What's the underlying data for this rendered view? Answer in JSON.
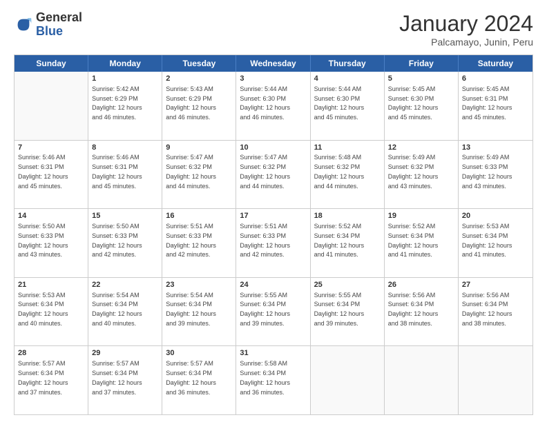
{
  "logo": {
    "general": "General",
    "blue": "Blue"
  },
  "title": "January 2024",
  "location": "Palcamayo, Junin, Peru",
  "days": [
    "Sunday",
    "Monday",
    "Tuesday",
    "Wednesday",
    "Thursday",
    "Friday",
    "Saturday"
  ],
  "weeks": [
    [
      {
        "day": "",
        "text": ""
      },
      {
        "day": "1",
        "text": "Sunrise: 5:42 AM\nSunset: 6:29 PM\nDaylight: 12 hours\nand 46 minutes."
      },
      {
        "day": "2",
        "text": "Sunrise: 5:43 AM\nSunset: 6:29 PM\nDaylight: 12 hours\nand 46 minutes."
      },
      {
        "day": "3",
        "text": "Sunrise: 5:44 AM\nSunset: 6:30 PM\nDaylight: 12 hours\nand 46 minutes."
      },
      {
        "day": "4",
        "text": "Sunrise: 5:44 AM\nSunset: 6:30 PM\nDaylight: 12 hours\nand 45 minutes."
      },
      {
        "day": "5",
        "text": "Sunrise: 5:45 AM\nSunset: 6:30 PM\nDaylight: 12 hours\nand 45 minutes."
      },
      {
        "day": "6",
        "text": "Sunrise: 5:45 AM\nSunset: 6:31 PM\nDaylight: 12 hours\nand 45 minutes."
      }
    ],
    [
      {
        "day": "7",
        "text": "Sunrise: 5:46 AM\nSunset: 6:31 PM\nDaylight: 12 hours\nand 45 minutes."
      },
      {
        "day": "8",
        "text": "Sunrise: 5:46 AM\nSunset: 6:31 PM\nDaylight: 12 hours\nand 45 minutes."
      },
      {
        "day": "9",
        "text": "Sunrise: 5:47 AM\nSunset: 6:32 PM\nDaylight: 12 hours\nand 44 minutes."
      },
      {
        "day": "10",
        "text": "Sunrise: 5:47 AM\nSunset: 6:32 PM\nDaylight: 12 hours\nand 44 minutes."
      },
      {
        "day": "11",
        "text": "Sunrise: 5:48 AM\nSunset: 6:32 PM\nDaylight: 12 hours\nand 44 minutes."
      },
      {
        "day": "12",
        "text": "Sunrise: 5:49 AM\nSunset: 6:32 PM\nDaylight: 12 hours\nand 43 minutes."
      },
      {
        "day": "13",
        "text": "Sunrise: 5:49 AM\nSunset: 6:33 PM\nDaylight: 12 hours\nand 43 minutes."
      }
    ],
    [
      {
        "day": "14",
        "text": "Sunrise: 5:50 AM\nSunset: 6:33 PM\nDaylight: 12 hours\nand 43 minutes."
      },
      {
        "day": "15",
        "text": "Sunrise: 5:50 AM\nSunset: 6:33 PM\nDaylight: 12 hours\nand 42 minutes."
      },
      {
        "day": "16",
        "text": "Sunrise: 5:51 AM\nSunset: 6:33 PM\nDaylight: 12 hours\nand 42 minutes."
      },
      {
        "day": "17",
        "text": "Sunrise: 5:51 AM\nSunset: 6:33 PM\nDaylight: 12 hours\nand 42 minutes."
      },
      {
        "day": "18",
        "text": "Sunrise: 5:52 AM\nSunset: 6:34 PM\nDaylight: 12 hours\nand 41 minutes."
      },
      {
        "day": "19",
        "text": "Sunrise: 5:52 AM\nSunset: 6:34 PM\nDaylight: 12 hours\nand 41 minutes."
      },
      {
        "day": "20",
        "text": "Sunrise: 5:53 AM\nSunset: 6:34 PM\nDaylight: 12 hours\nand 41 minutes."
      }
    ],
    [
      {
        "day": "21",
        "text": "Sunrise: 5:53 AM\nSunset: 6:34 PM\nDaylight: 12 hours\nand 40 minutes."
      },
      {
        "day": "22",
        "text": "Sunrise: 5:54 AM\nSunset: 6:34 PM\nDaylight: 12 hours\nand 40 minutes."
      },
      {
        "day": "23",
        "text": "Sunrise: 5:54 AM\nSunset: 6:34 PM\nDaylight: 12 hours\nand 39 minutes."
      },
      {
        "day": "24",
        "text": "Sunrise: 5:55 AM\nSunset: 6:34 PM\nDaylight: 12 hours\nand 39 minutes."
      },
      {
        "day": "25",
        "text": "Sunrise: 5:55 AM\nSunset: 6:34 PM\nDaylight: 12 hours\nand 39 minutes."
      },
      {
        "day": "26",
        "text": "Sunrise: 5:56 AM\nSunset: 6:34 PM\nDaylight: 12 hours\nand 38 minutes."
      },
      {
        "day": "27",
        "text": "Sunrise: 5:56 AM\nSunset: 6:34 PM\nDaylight: 12 hours\nand 38 minutes."
      }
    ],
    [
      {
        "day": "28",
        "text": "Sunrise: 5:57 AM\nSunset: 6:34 PM\nDaylight: 12 hours\nand 37 minutes."
      },
      {
        "day": "29",
        "text": "Sunrise: 5:57 AM\nSunset: 6:34 PM\nDaylight: 12 hours\nand 37 minutes."
      },
      {
        "day": "30",
        "text": "Sunrise: 5:57 AM\nSunset: 6:34 PM\nDaylight: 12 hours\nand 36 minutes."
      },
      {
        "day": "31",
        "text": "Sunrise: 5:58 AM\nSunset: 6:34 PM\nDaylight: 12 hours\nand 36 minutes."
      },
      {
        "day": "",
        "text": ""
      },
      {
        "day": "",
        "text": ""
      },
      {
        "day": "",
        "text": ""
      }
    ]
  ]
}
